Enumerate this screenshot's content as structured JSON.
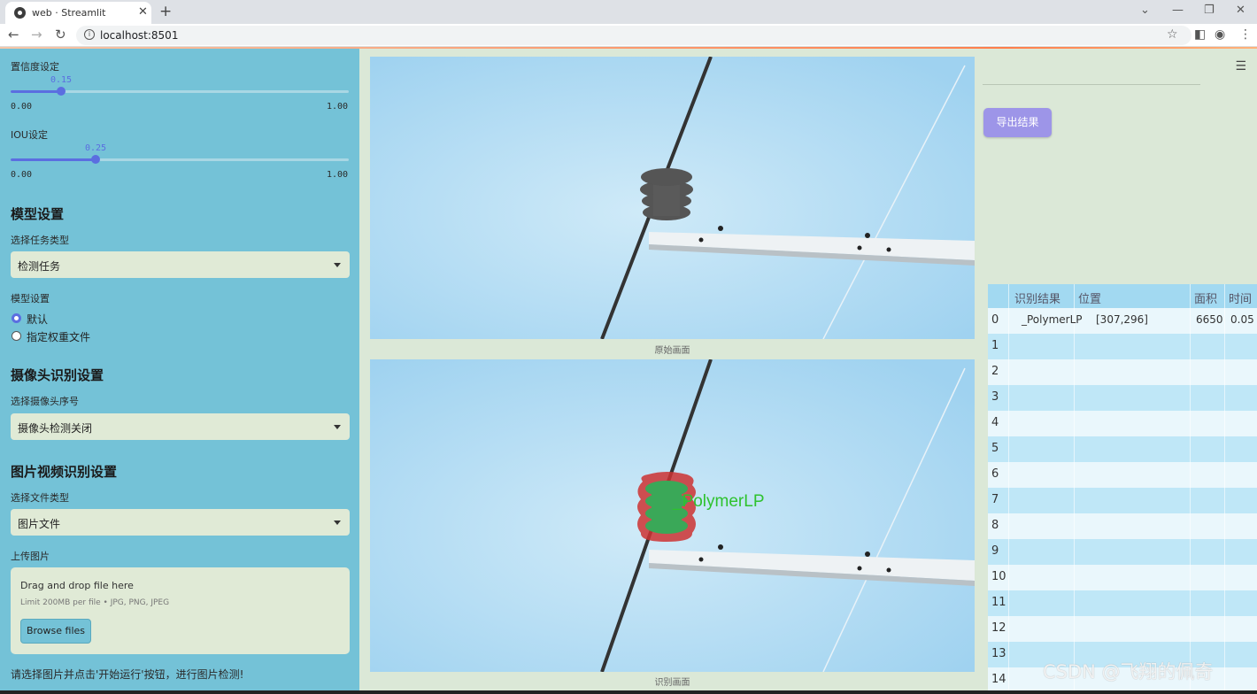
{
  "browser": {
    "tab_title": "web · Streamlit",
    "url": "localhost:8501"
  },
  "sidebar": {
    "confidence": {
      "label": "置信度设定",
      "value": "0.15",
      "fraction": 0.15,
      "min": "0.00",
      "max": "1.00"
    },
    "iou": {
      "label": "IOU设定",
      "value": "0.25",
      "fraction": 0.25,
      "min": "0.00",
      "max": "1.00"
    },
    "model_header": "模型设置",
    "task_label": "选择任务类型",
    "task_value": "检测任务",
    "model_label": "模型设置",
    "radio_options": [
      "默认",
      "指定权重文件"
    ],
    "radio_selected": 0,
    "camera_header": "摄像头识别设置",
    "camera_label": "选择摄像头序号",
    "camera_value": "摄像头检测关闭",
    "media_header": "图片视频识别设置",
    "file_type_label": "选择文件类型",
    "file_type_value": "图片文件",
    "upload_label": "上传图片",
    "dropzone_title": "Drag and drop file here",
    "dropzone_hint": "Limit 200MB per file • JPG, PNG, JPEG",
    "browse_label": "Browse files",
    "hint": "请选择图片并点击'开始运行'按钮，进行图片检测!"
  },
  "main": {
    "original_caption": "原始画面",
    "result_caption": "识别画面",
    "detection_label": "_PolymerLP",
    "export_label": "导出结果",
    "table": {
      "headers": [
        "",
        "识别结果",
        "位置",
        "面积",
        "时间"
      ],
      "rows": [
        [
          "0",
          "_PolymerLP",
          "[307,296]",
          "6650",
          "0.05"
        ],
        [
          "1",
          "",
          "",
          "",
          ""
        ],
        [
          "2",
          "",
          "",
          "",
          ""
        ],
        [
          "3",
          "",
          "",
          "",
          ""
        ],
        [
          "4",
          "",
          "",
          "",
          ""
        ],
        [
          "5",
          "",
          "",
          "",
          ""
        ],
        [
          "6",
          "",
          "",
          "",
          ""
        ],
        [
          "7",
          "",
          "",
          "",
          ""
        ],
        [
          "8",
          "",
          "",
          "",
          ""
        ],
        [
          "9",
          "",
          "",
          "",
          ""
        ],
        [
          "10",
          "",
          "",
          "",
          ""
        ],
        [
          "11",
          "",
          "",
          "",
          ""
        ],
        [
          "12",
          "",
          "",
          "",
          ""
        ],
        [
          "13",
          "",
          "",
          "",
          ""
        ],
        [
          "14",
          "",
          "",
          "",
          ""
        ]
      ]
    }
  },
  "watermark": "CSDN @飞翔的佩奇"
}
